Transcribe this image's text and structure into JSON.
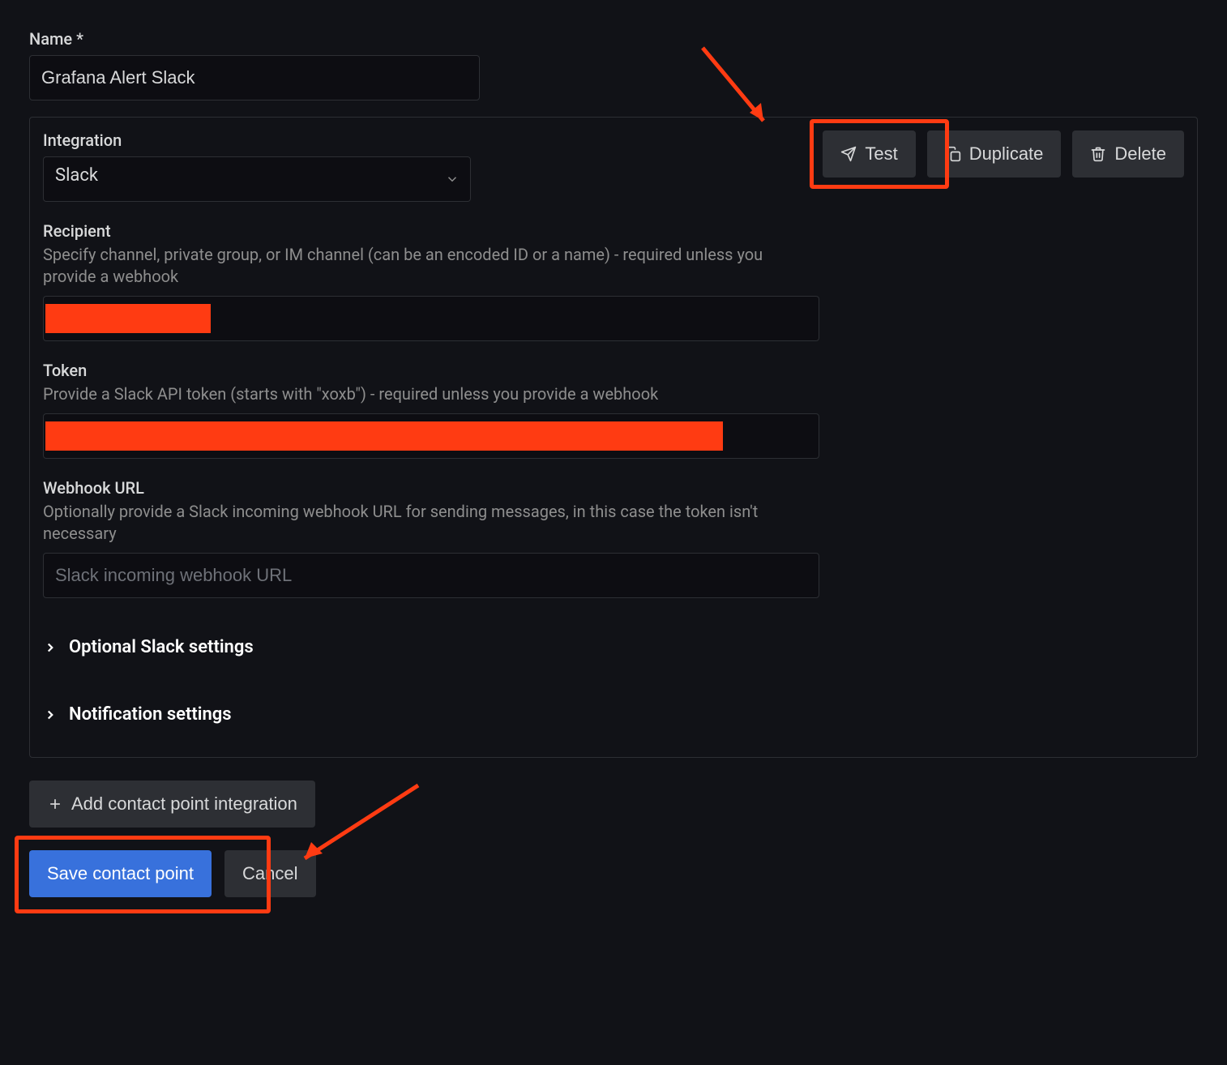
{
  "name_field": {
    "label": "Name *",
    "value": "Grafana Alert Slack"
  },
  "integration": {
    "label": "Integration",
    "value": "Slack"
  },
  "buttons": {
    "test": "Test",
    "duplicate": "Duplicate",
    "delete": "Delete",
    "add_integration": "Add contact point integration",
    "save": "Save contact point",
    "cancel": "Cancel"
  },
  "recipient": {
    "label": "Recipient",
    "help": "Specify channel, private group, or IM channel (can be an encoded ID or a name) - required unless you provide a webhook"
  },
  "token": {
    "label": "Token",
    "help": "Provide a Slack API token (starts with \"xoxb\") - required unless you provide a webhook"
  },
  "webhook": {
    "label": "Webhook URL",
    "help": "Optionally provide a Slack incoming webhook URL for sending messages, in this case the token isn't necessary",
    "placeholder": "Slack incoming webhook URL"
  },
  "expanders": {
    "optional": "Optional Slack settings",
    "notification": "Notification settings"
  }
}
